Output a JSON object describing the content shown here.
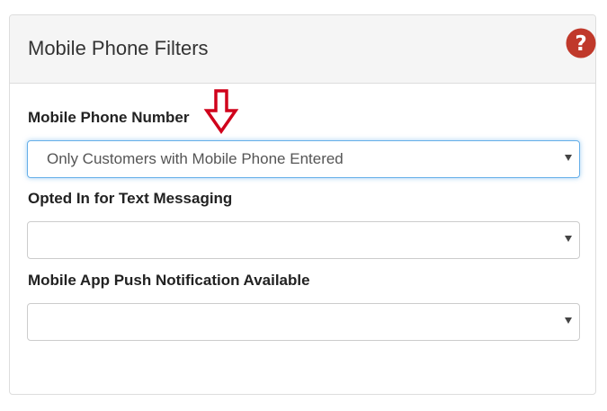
{
  "panel": {
    "title": "Mobile Phone Filters",
    "help_icon": "question-circle-icon"
  },
  "fields": [
    {
      "label": "Mobile Phone Number",
      "selected_value": "Only Customers with Mobile Phone Entered"
    },
    {
      "label": "Opted In for Text Messaging",
      "selected_value": ""
    },
    {
      "label": "Mobile App Push Notification Available",
      "selected_value": ""
    }
  ],
  "annotation": {
    "icon": "down-arrow-icon",
    "color": "#d0021b"
  },
  "colors": {
    "help_icon": "#c0392b",
    "focus_border": "#66afe9"
  }
}
